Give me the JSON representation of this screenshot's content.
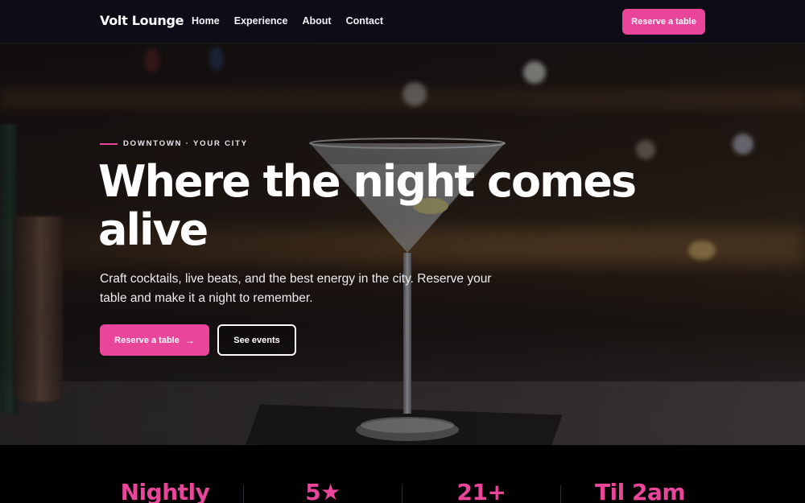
{
  "nav": {
    "brand": "Volt Lounge",
    "links": [
      "Home",
      "Experience",
      "About",
      "Contact"
    ],
    "cta_label": "Reserve a table"
  },
  "hero": {
    "eyebrow": "DOWNTOWN · YOUR CITY",
    "headline": "Where the night comes alive",
    "subtext": "Craft cocktails, live beats, and the best energy in the city. Reserve your table and make it a night to remember.",
    "primary_button": "Reserve a table",
    "primary_button_icon": "→",
    "secondary_button": "See events",
    "background_image": "martini-glass-on-bar"
  },
  "stats": [
    "Nightly",
    "5★",
    "21+",
    "Til 2am"
  ],
  "colors": {
    "accent": "#e8459b",
    "nav_bg": "#0e0c17",
    "stats_bg": "#000000"
  }
}
